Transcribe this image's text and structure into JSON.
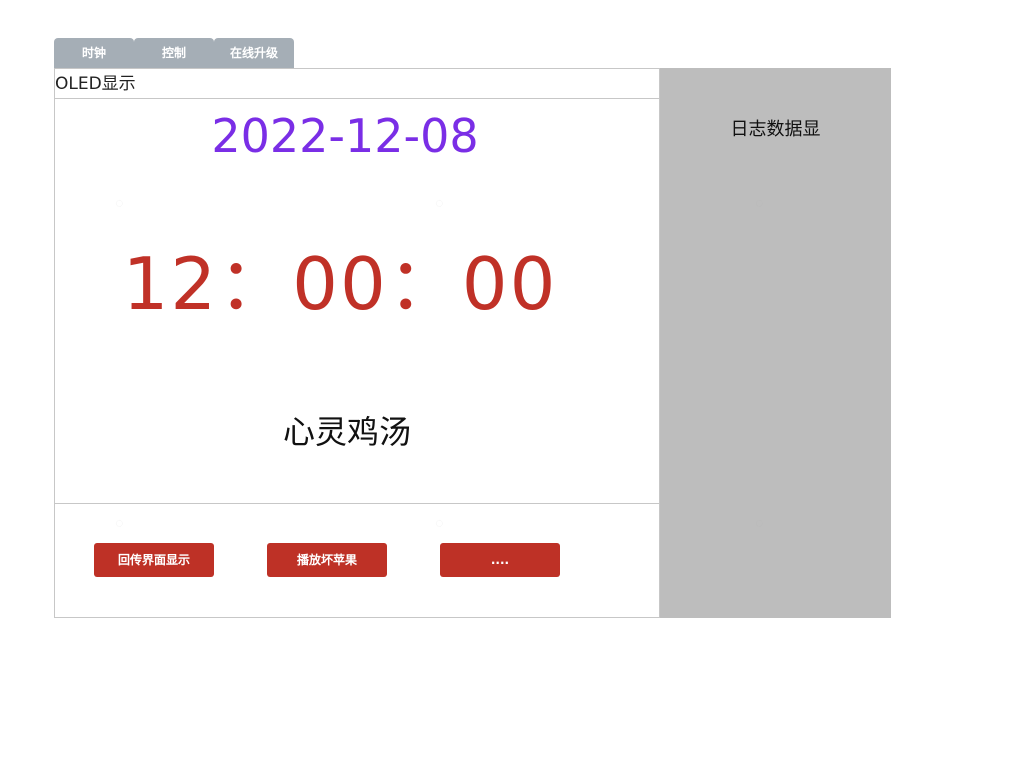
{
  "tabs": [
    "时钟",
    "控制",
    "在线升级"
  ],
  "oled": {
    "header": "OLED显示",
    "date": "2022-12-08",
    "time": "12：00：00",
    "quote": "心灵鸡汤"
  },
  "buttons": [
    "回传界面显示",
    "播放坏苹果",
    "...."
  ],
  "log": {
    "title": "日志数据显"
  },
  "colors": {
    "tab_bg": "#a5aeb6",
    "date": "#7a2ee6",
    "time": "#c03127",
    "button": "#be3126",
    "log_bg": "#bdbdbd"
  }
}
